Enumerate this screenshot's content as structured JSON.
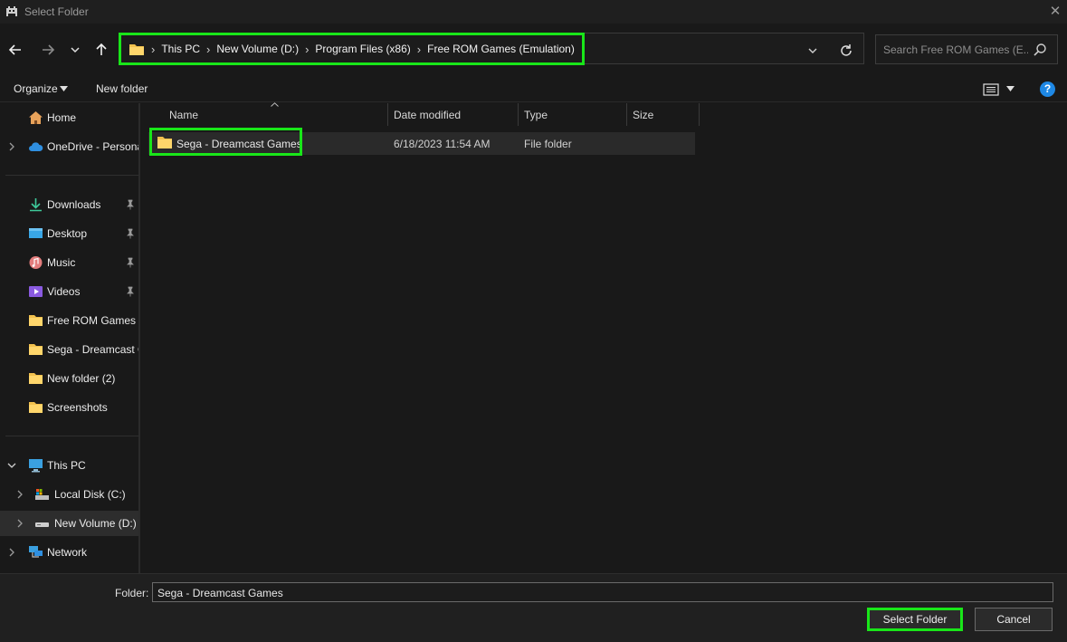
{
  "window": {
    "title": "Select Folder",
    "close_glyph": "✕"
  },
  "address": {
    "crumbs": [
      "This PC",
      "New Volume (D:)",
      "Program Files (x86)",
      "Free ROM Games (Emulation)"
    ],
    "separator": "›"
  },
  "search": {
    "placeholder": "Search Free ROM Games (E..."
  },
  "commands": {
    "organize_label": "Organize",
    "new_folder_label": "New folder",
    "help_glyph": "?"
  },
  "sidebar": {
    "items": [
      {
        "label": "Home",
        "icon": "home-icon"
      },
      {
        "label": "OneDrive - Personal",
        "icon": "cloud-icon"
      },
      {
        "label": "Downloads",
        "icon": "download-icon",
        "pinned": true
      },
      {
        "label": "Desktop",
        "icon": "desktop-icon",
        "pinned": true
      },
      {
        "label": "Music",
        "icon": "music-icon",
        "pinned": true
      },
      {
        "label": "Videos",
        "icon": "video-icon",
        "pinned": true
      },
      {
        "label": "Free ROM Games (Emulation)",
        "icon": "folder-icon"
      },
      {
        "label": "Sega - Dreamcast Games",
        "icon": "folder-icon"
      },
      {
        "label": "New folder (2)",
        "icon": "folder-icon"
      },
      {
        "label": "Screenshots",
        "icon": "folder-icon"
      },
      {
        "label": "This PC",
        "icon": "pc-icon"
      },
      {
        "label": "Local Disk (C:)",
        "icon": "drive-icon"
      },
      {
        "label": "New Volume (D:)",
        "icon": "drive-icon"
      },
      {
        "label": "Network",
        "icon": "network-icon"
      }
    ]
  },
  "columns": {
    "name": "Name",
    "date_modified": "Date modified",
    "type": "Type",
    "size": "Size"
  },
  "files": [
    {
      "name": "Sega - Dreamcast Games",
      "date_modified": "6/18/2023 11:54 AM",
      "type": "File folder",
      "size": ""
    }
  ],
  "footer": {
    "folder_label": "Folder:",
    "folder_value": "Sega - Dreamcast Games",
    "select_label": "Select Folder",
    "cancel_label": "Cancel"
  },
  "colors": {
    "highlight": "#19e619",
    "folder": "#f2c14e",
    "accent": "#1e88e5"
  }
}
